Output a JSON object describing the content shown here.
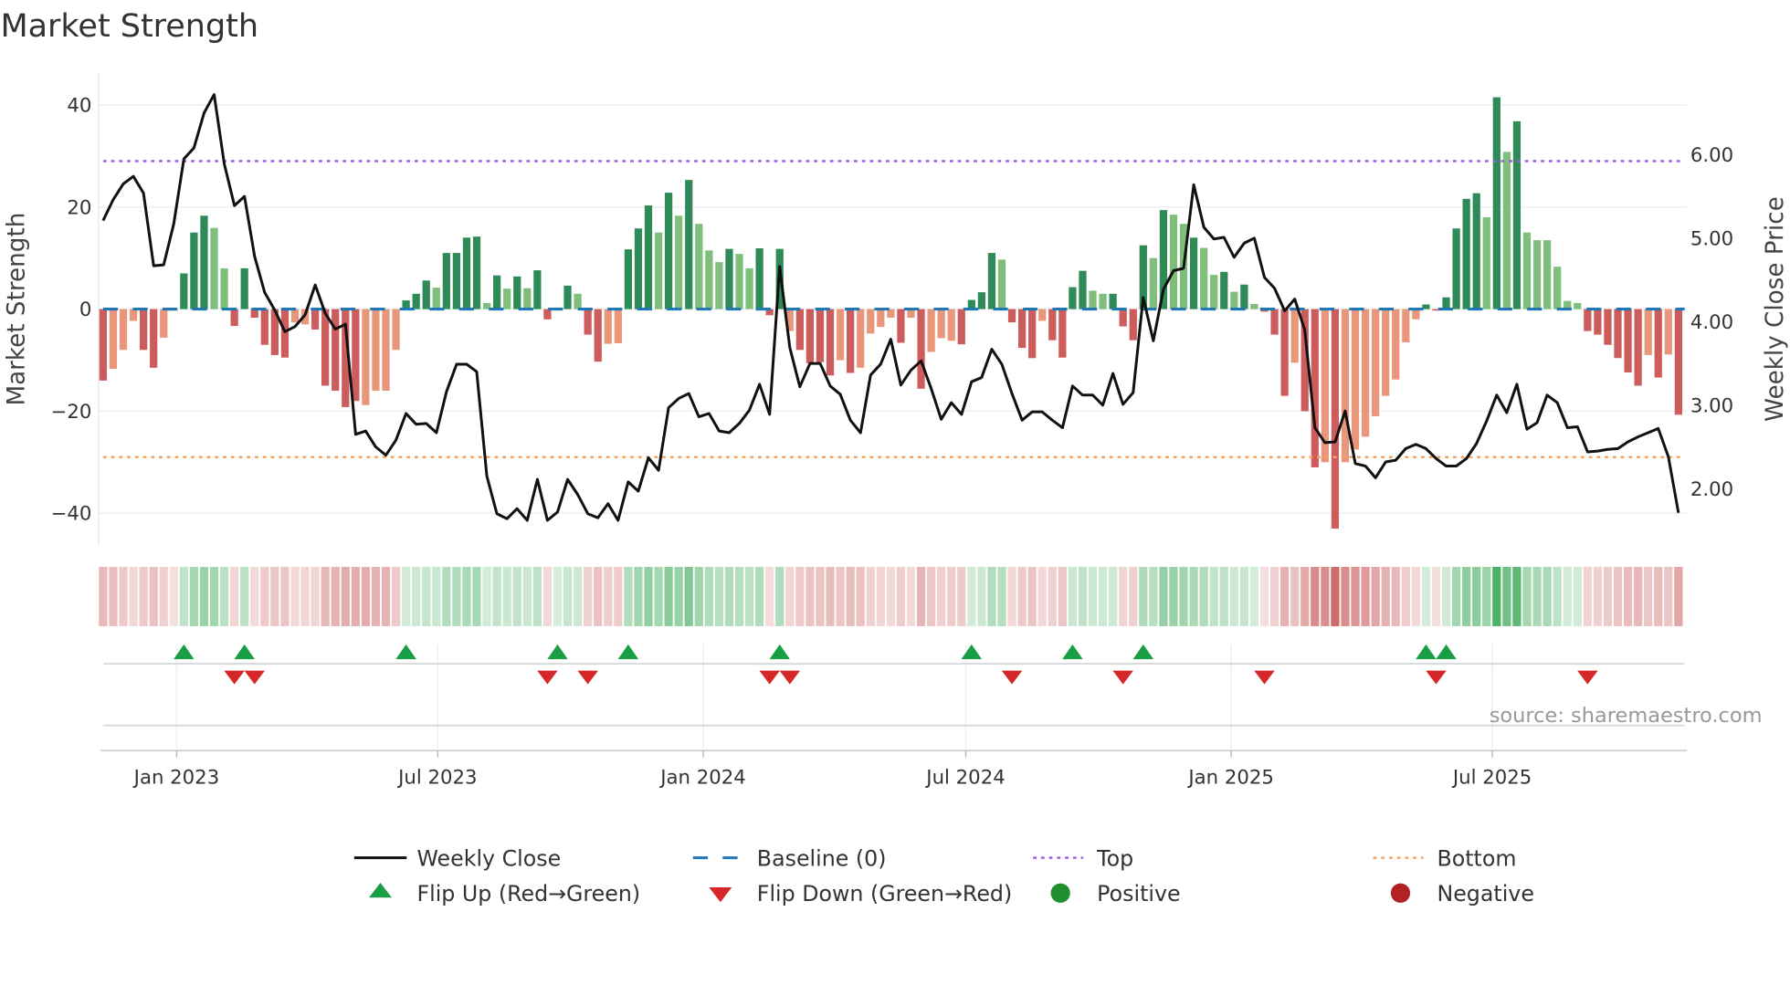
{
  "chart_data": {
    "type": "bar+line",
    "title": "Market Strength",
    "ylabel_left": "Market Strength",
    "ylabel_right": "Weekly Close Price",
    "ylim_left": [
      -46,
      46
    ],
    "y_ticks_left": [
      {
        "value": 40,
        "label": "40"
      },
      {
        "value": 20,
        "label": "20"
      },
      {
        "value": 0,
        "label": "0"
      },
      {
        "value": -20,
        "label": "−20"
      },
      {
        "value": -40,
        "label": "−40"
      }
    ],
    "y_ticks_right": [
      {
        "value": 6,
        "label": "6.00"
      },
      {
        "value": 5,
        "label": "5.00"
      },
      {
        "value": 4,
        "label": "4.00"
      },
      {
        "value": 3,
        "label": "3.00"
      },
      {
        "value": 2,
        "label": "2.00"
      }
    ],
    "x_start": "2022-11-11",
    "x_step_days": 7,
    "x_ticks": [
      {
        "date": "2023-01-01",
        "label": "Jan 2023"
      },
      {
        "date": "2023-07-01",
        "label": "Jul 2023"
      },
      {
        "date": "2024-01-01",
        "label": "Jan 2024"
      },
      {
        "date": "2024-07-01",
        "label": "Jul 2024"
      },
      {
        "date": "2025-01-01",
        "label": "Jan 2025"
      },
      {
        "date": "2025-07-01",
        "label": "Jul 2025"
      }
    ],
    "top_level": 29,
    "bottom_level": -29,
    "baseline": 0,
    "strength": [
      -14,
      -11.7,
      -8,
      -2.3,
      -8,
      -11.5,
      -5.6,
      -0.3,
      7,
      15,
      18.3,
      15.9,
      8,
      -3.3,
      8,
      -1.7,
      -7,
      -9,
      -9.5,
      -2.6,
      -3,
      -4,
      -15,
      -16,
      -19.2,
      -18,
      -18.8,
      -16,
      -16,
      -8,
      1.7,
      3,
      5.6,
      4.2,
      11,
      11,
      14,
      14.2,
      1.2,
      6.6,
      4,
      6.4,
      4.1,
      7.6,
      -2,
      0.3,
      4.6,
      3,
      -5,
      -10.3,
      -6.8,
      -6.7,
      11.7,
      15.8,
      20.3,
      15,
      22.8,
      18.3,
      25.3,
      16.7,
      11.5,
      9.2,
      11.8,
      10.8,
      8,
      11.9,
      -1.2,
      11.8,
      -4.3,
      -8,
      -10.6,
      -10.4,
      -13,
      -10,
      -12.5,
      -11.5,
      -4.8,
      -3.5,
      -1.7,
      -6.6,
      -1.7,
      -15.6,
      -8.4,
      -5.7,
      -6.2,
      -6.9,
      1.8,
      3.3,
      11,
      9.7,
      -2.6,
      -7.6,
      -9.6,
      -2.3,
      -6.1,
      -9.5,
      4.3,
      7.5,
      3.6,
      3,
      3,
      -3.4,
      -6.1,
      12.5,
      10,
      19.4,
      18.5,
      16.7,
      14,
      12,
      6.7,
      7.3,
      3.4,
      4.8,
      1,
      -0.5,
      -5,
      -17,
      -10.5,
      -20,
      -31,
      -30,
      -43,
      -30,
      -27.5,
      -25,
      -21,
      -17,
      -13.8,
      -6.5,
      -2,
      0.9,
      -0.3,
      2.3,
      15.8,
      21.6,
      22.7,
      18,
      41.5,
      30.8,
      36.8,
      15,
      13.5,
      13.5,
      8.3,
      1.6,
      1.2,
      -4.3,
      -5,
      -7,
      -9.6,
      -12.4,
      -15,
      -9,
      -13.4,
      -8.9,
      -20.7
    ],
    "shade": "SWWWSSWWSSSWWSSSSSSWWSSSSSWWWWSSSWSSSSWSWSWSSSSWSSWWSSSWSWSWWWSWWSSSWSSSSWSWWWWSWSWWWSSSSWSSSWSSSSWWSSSSWSWWSWWSWSWSSSWSSWSWWWWWWWWSSSSSSWSWSWWWWWWSSSSSSWSWS",
    "close": [
      5.21,
      5.46,
      5.65,
      5.74,
      5.54,
      4.67,
      4.68,
      5.17,
      5.95,
      6.08,
      6.5,
      6.72,
      5.89,
      5.39,
      5.5,
      4.78,
      4.35,
      4.14,
      3.88,
      3.94,
      4.08,
      4.44,
      4.1,
      3.91,
      3.97,
      2.65,
      2.69,
      2.5,
      2.4,
      2.58,
      2.9,
      2.77,
      2.78,
      2.67,
      3.16,
      3.49,
      3.49,
      3.4,
      2.15,
      1.7,
      1.64,
      1.76,
      1.62,
      2.11,
      1.62,
      1.72,
      2.11,
      1.93,
      1.7,
      1.65,
      1.82,
      1.62,
      2.08,
      1.97,
      2.37,
      2.22,
      2.97,
      3.08,
      3.14,
      2.86,
      2.9,
      2.69,
      2.67,
      2.78,
      2.94,
      3.25,
      2.89,
      4.66,
      3.69,
      3.22,
      3.5,
      3.5,
      3.23,
      3.13,
      2.82,
      2.67,
      3.36,
      3.49,
      3.79,
      3.24,
      3.42,
      3.53,
      3.2,
      2.83,
      3.03,
      2.89,
      3.28,
      3.33,
      3.67,
      3.49,
      3.14,
      2.82,
      2.92,
      2.92,
      2.82,
      2.73,
      3.23,
      3.12,
      3.12,
      3.0,
      3.38,
      3.01,
      3.15,
      4.29,
      3.77,
      4.39,
      4.61,
      4.64,
      5.64,
      5.13,
      4.99,
      5.01,
      4.77,
      4.94,
      5.0,
      4.53,
      4.4,
      4.13,
      4.27,
      3.9,
      2.73,
      2.55,
      2.56,
      2.93,
      2.3,
      2.27,
      2.13,
      2.32,
      2.34,
      2.48,
      2.53,
      2.48,
      2.36,
      2.27,
      2.27,
      2.36,
      2.54,
      2.81,
      3.12,
      2.91,
      3.25,
      2.71,
      2.79,
      3.12,
      3.03,
      2.73,
      2.74,
      2.44,
      2.45,
      2.47,
      2.48,
      2.56,
      2.62,
      2.67,
      2.72,
      2.38,
      1.71
    ],
    "flip_up": [
      8,
      14,
      30,
      45,
      52,
      67,
      86,
      96,
      103,
      131,
      133
    ],
    "flip_down": [
      13,
      15,
      44,
      48,
      66,
      68,
      90,
      101,
      115,
      132,
      147
    ],
    "legend": [
      {
        "label": "Weekly Close",
        "kind": "line"
      },
      {
        "label": "Baseline (0)",
        "kind": "dash"
      },
      {
        "label": "Top",
        "kind": "dot-top"
      },
      {
        "label": "Bottom",
        "kind": "dot-bottom"
      },
      {
        "label": "Flip Up (Red→Green)",
        "kind": "tri-up"
      },
      {
        "label": "Flip Down (Green→Red)",
        "kind": "tri-down"
      },
      {
        "label": "Positive",
        "kind": "dot-pos"
      },
      {
        "label": "Negative",
        "kind": "dot-neg"
      }
    ],
    "legend_placement": "bottom",
    "source": "source: sharemaestro.com",
    "colors": {
      "pos_strong": "#2e8b57",
      "pos_weak": "#7fbf7b",
      "neg_strong": "#cd5c5c",
      "neg_weak": "#e9967a",
      "line": "#111111",
      "baseline": "#1f77b4",
      "top": "#9b5de5",
      "bottom": "#f4a460",
      "flip_up": "#1a9e45",
      "flip_down": "#d62728",
      "positive": "#1f8f2f",
      "negative": "#b22222"
    }
  }
}
